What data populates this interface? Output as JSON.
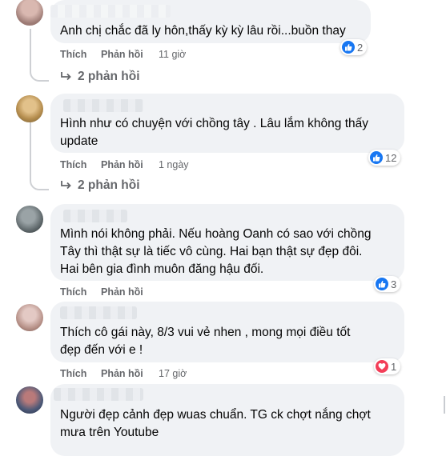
{
  "comments": [
    {
      "text": "Anh chị chắc đã ly hôn,thấy kỳ kỳ lâu rồi...buồn thay",
      "like_label": "Thích",
      "reply_label": "Phản hồi",
      "time": "11 giờ",
      "reaction_count": "2",
      "reaction_type": "like-icon",
      "replies_label": "2 phản hồi"
    },
    {
      "text": "Hình như có chuyện với chồng tây . Lâu lắm không thấy\nupdate",
      "like_label": "Thích",
      "reply_label": "Phản hồi",
      "time": "1 ngày",
      "reaction_count": "12",
      "reaction_type": "like-icon",
      "replies_label": "2 phản hồi"
    },
    {
      "text": "Mình nói không phải. Nếu hoàng Oanh có sao với chồng\nTây thì thật sự là tiếc vô cùng. Hai bạn thật sự đẹp đôi.\nHai bên gia đình muôn đăng hậu đối.",
      "like_label": "Thích",
      "reply_label": "Phản hồi",
      "time": "",
      "reaction_count": "3",
      "reaction_type": "like-icon"
    },
    {
      "text": "Thích cô gái này, 8/3 vui vẻ nhen , mong mọi điều tốt\nđẹp đến với e !",
      "like_label": "Thích",
      "reply_label": "Phản hồi",
      "time": "17 giờ",
      "reaction_count": "1",
      "reaction_type": "heart-icon"
    },
    {
      "text": "Người đẹp cảnh đẹp wuas chuẩn. TG ck chợt nắng chợt\nmưa trên Youtube"
    }
  ],
  "colors": {
    "bubble_bg": "#f0f2f5",
    "secondary_text": "#65676b",
    "like_blue": "#1877f2",
    "heart_red": "#f33e58"
  }
}
